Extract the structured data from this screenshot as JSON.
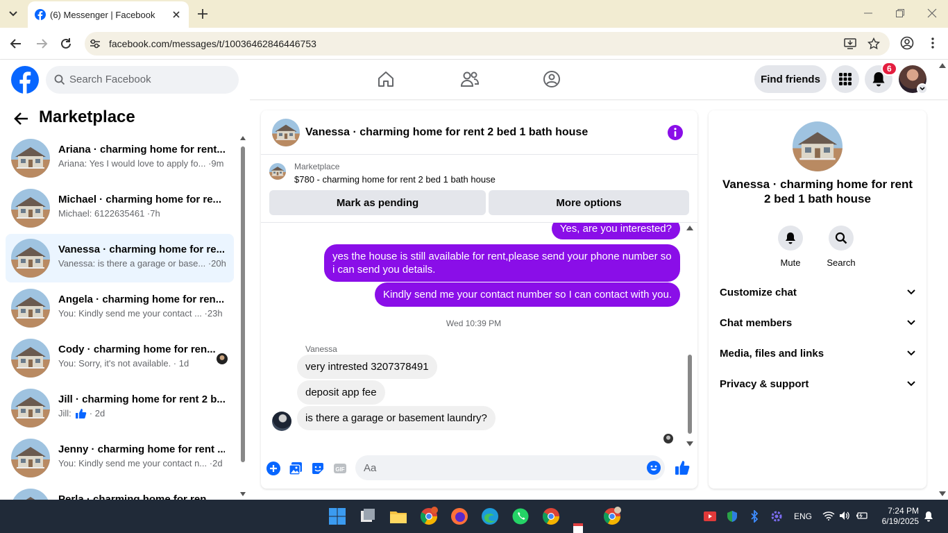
{
  "browser": {
    "tab_title": "(6) Messenger | Facebook",
    "url": "facebook.com/messages/t/10036462846446753"
  },
  "header": {
    "search_placeholder": "Search Facebook",
    "find_friends": "Find friends",
    "notification_count": "6"
  },
  "left": {
    "title": "Marketplace",
    "conversations": [
      {
        "name": "Ariana · charming home for rent...",
        "snippet": "Ariana: Yes I would love to apply fo... ·9m"
      },
      {
        "name": "Michael · charming home for re...",
        "snippet": "Michael: 6122635461 ·7h"
      },
      {
        "name": "Vanessa · charming home for re...",
        "snippet": "Vanessa: is there a garage or base... ·20h"
      },
      {
        "name": "Angela · charming home for ren...",
        "snippet": "You: Kindly send me your contact ... ·23h"
      },
      {
        "name": "Cody · charming home for ren...",
        "snippet": "You: Sorry, it's not available. · 1d"
      },
      {
        "name": "Jill · charming home for rent 2 b...",
        "snippet_prefix": "Jill:",
        "snippet": "· 2d"
      },
      {
        "name": "Jenny · charming home for rent ...",
        "snippet": "You: Kindly send me your contact n... ·2d"
      },
      {
        "name": "Perla · charming home for ren...",
        "snippet": ""
      }
    ]
  },
  "chat": {
    "title": "Vanessa · charming home for rent 2 bed 1 bath house",
    "marketplace_label": "Marketplace",
    "listing": "$780 - charming home for rent 2 bed 1 bath house",
    "mark_pending": "Mark as pending",
    "more_options": "More options",
    "outgoing": [
      "Yes, are you interested?",
      "yes the house is still available for rent,please send your phone number so i can send you details.",
      "Kindly send me your contact number so I can contact with you."
    ],
    "timestamp": "Wed 10:39 PM",
    "sender": "Vanessa",
    "incoming": [
      "very intrested 3207378491",
      "deposit app fee",
      "is there a garage or basement laundry?"
    ],
    "input_placeholder": "Aa"
  },
  "info": {
    "name": "Vanessa · charming home for rent 2 bed 1 bath house",
    "mute": "Mute",
    "search": "Search",
    "sections": [
      "Customize chat",
      "Chat members",
      "Media, files and links",
      "Privacy & support"
    ]
  },
  "taskbar": {
    "lang": "ENG",
    "time": "7:24 PM",
    "date": "6/19/2025"
  },
  "colors": {
    "messenger_purple": "#8a0ee8",
    "facebook_blue": "#0866ff",
    "taskbar": "#202a38"
  }
}
